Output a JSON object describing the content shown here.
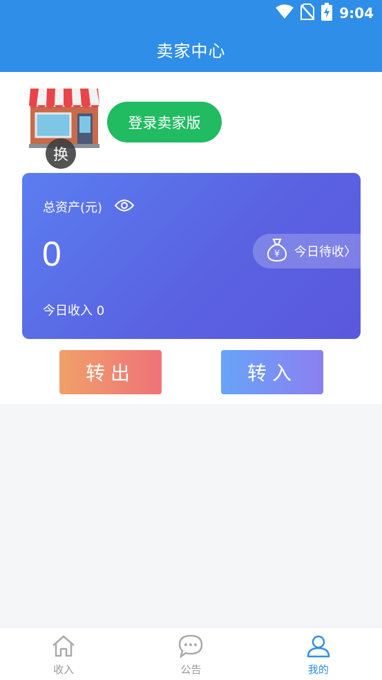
{
  "status_bar": {
    "time": "9:04",
    "icons": [
      "wifi-icon",
      "no-sim-icon",
      "battery-charging-icon"
    ]
  },
  "app_bar": {
    "title": "卖家中心"
  },
  "shop": {
    "icon": "storefront-icon",
    "swap_label": "换",
    "login_button": "登录卖家版"
  },
  "asset_card": {
    "label": "总资产(元)",
    "eye_icon": "eye-icon",
    "value": "0",
    "pending_label": "今日待收〉",
    "pending_icon": "money-bag-icon",
    "today_income": "今日收入 0"
  },
  "actions": {
    "transfer_out": "转出",
    "transfer_in": "转入"
  },
  "tabs": [
    {
      "label": "收入",
      "icon": "home-icon",
      "active": false
    },
    {
      "label": "公告",
      "icon": "chat-bubble-icon",
      "active": false
    },
    {
      "label": "我的",
      "icon": "user-icon",
      "active": true
    }
  ],
  "colors": {
    "primary": "#2f8ee8",
    "login_green": "#21bb62",
    "inactive_tab": "#999999"
  }
}
